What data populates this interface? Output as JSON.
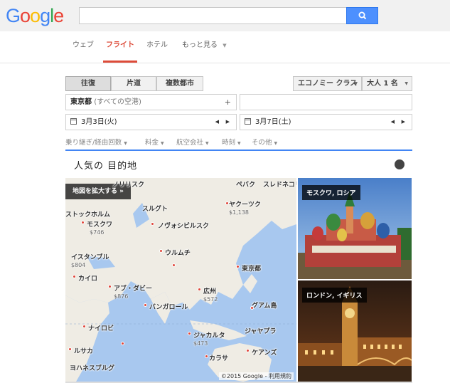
{
  "header": {
    "logo_letters": [
      {
        "ch": "G",
        "color": "#4285f4"
      },
      {
        "ch": "o",
        "color": "#ea4335"
      },
      {
        "ch": "o",
        "color": "#fbbc05"
      },
      {
        "ch": "g",
        "color": "#4285f4"
      },
      {
        "ch": "l",
        "color": "#34a853"
      },
      {
        "ch": "e",
        "color": "#ea4335"
      }
    ],
    "search_value": "",
    "search_icon": "magnifier-icon"
  },
  "nav": {
    "items": [
      "ウェブ",
      "フライト",
      "ホテル",
      "もっと見る"
    ],
    "active": "フライト",
    "accent": "#dd4b39"
  },
  "trip": {
    "types": [
      "往復",
      "片道",
      "複数都市"
    ],
    "selected": "往復",
    "cabin": "エコノミー クラス",
    "passengers": "大人 1 名"
  },
  "route": {
    "origin_main": "東京都",
    "origin_sub": "(すべての空港)",
    "destination": ""
  },
  "dates": {
    "depart": "3月3日(火)",
    "return": "3月7日(土)"
  },
  "filters": [
    "乗り継ぎ/経由回数",
    "料金",
    "航空会社",
    "時刻",
    "その他"
  ],
  "destinations": {
    "title": "人気の 目的地",
    "enlarge_map": "地図を拡大する »",
    "map_footer": "©2015 Google - 利用規約",
    "map_labels": [
      "ノリリスク",
      "ヤクーツク",
      "ペバク",
      "スレドネコリムスク",
      "ストックホルム",
      "モスクワ",
      "スルグト",
      "ノヴォシビルスク",
      "ウルムチ",
      "イスタンブル",
      "カイロ",
      "アブ・ダビー",
      "東京都",
      "広州",
      "バンガロール",
      "グアム島",
      "ナイロビ",
      "ジャカルタ",
      "ジャヤプラ",
      "ルサカ",
      "ヨハネスブルグ",
      "カラサ",
      "ケアンズ"
    ],
    "map_prices": [
      "$1,138",
      "$746",
      "$804",
      "$876",
      "$572",
      "$473"
    ],
    "cards": [
      {
        "label": "モスクワ, ロシア"
      },
      {
        "label": "ロンドン, イギリス"
      }
    ]
  }
}
